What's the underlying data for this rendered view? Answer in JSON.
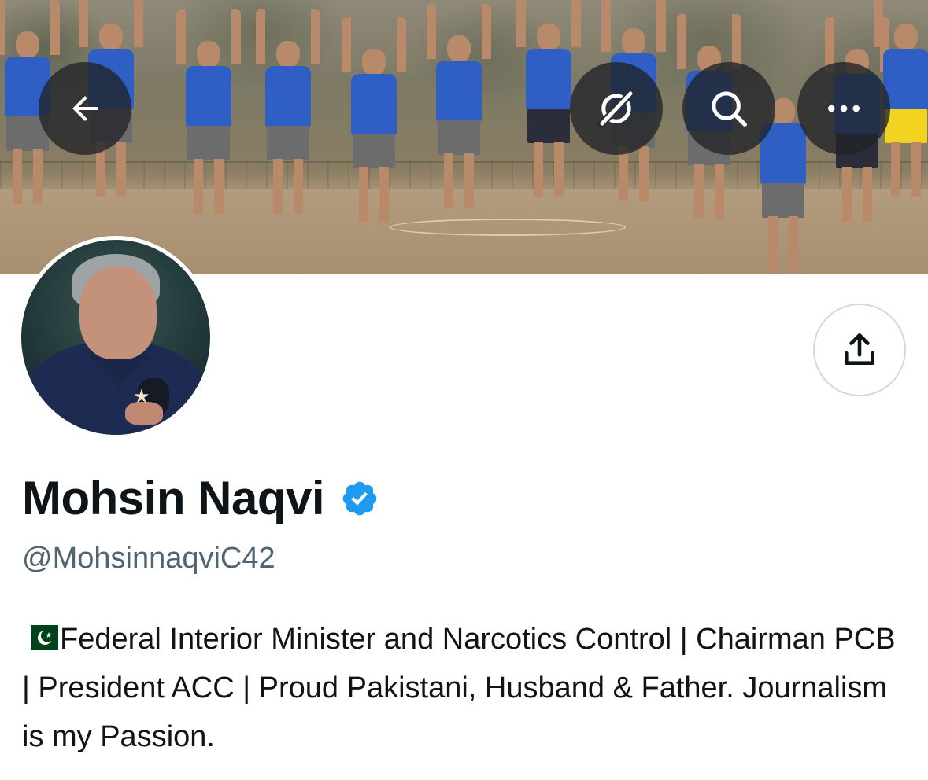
{
  "header": {
    "banner_image": "banner-team-jumping-photo",
    "back_button": {
      "icon": "back-arrow-icon"
    },
    "grok_button": {
      "icon": "grok-icon"
    },
    "search_button": {
      "icon": "search-icon"
    },
    "more_button": {
      "icon": "more-icon"
    }
  },
  "profile": {
    "avatar": "profile-photo",
    "share_button": {
      "icon": "share-icon"
    },
    "name": "Mohsin Naqvi",
    "verified_badge": {
      "icon": "verified-badge-icon",
      "color": "#1d9bf0"
    },
    "handle": "@MohsinnaqviC42",
    "bio": {
      "flag": "pakistan-flag-icon",
      "text": "Federal Interior Minister and Narcotics Control | Chairman PCB | President ACC | Proud Pakistani, Husband & Father. Journalism is my Passion."
    }
  },
  "colors": {
    "text_primary": "#0f1419",
    "text_secondary": "#536471",
    "accent": "#1d9bf0",
    "overlay_button": "#202328",
    "border": "#cfd9de"
  }
}
